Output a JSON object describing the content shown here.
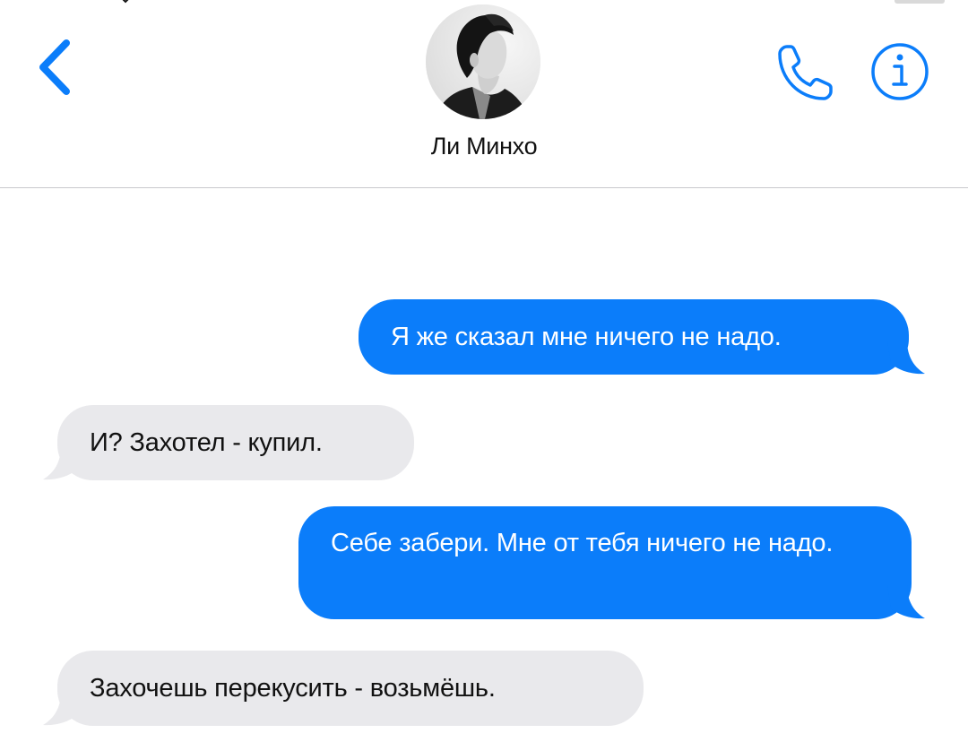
{
  "header": {
    "contact_name": "Ли Минхо",
    "back_icon": "chevron-left-icon",
    "call_icon": "phone-icon",
    "info_icon": "info-icon",
    "accent_color": "#0b7dfa"
  },
  "messages": [
    {
      "direction": "outgoing",
      "text": "Я же сказал мне ничего не надо."
    },
    {
      "direction": "incoming",
      "text": "И? Захотел - купил."
    },
    {
      "direction": "outgoing",
      "text": "Себе забери. Мне от тебя ничего не надо."
    },
    {
      "direction": "incoming",
      "text": "Захочешь перекусить - возьмёшь."
    }
  ],
  "colors": {
    "outgoing_bubble": "#0b7dfa",
    "incoming_bubble": "#e9e9ec",
    "divider": "#c8c8cc"
  }
}
